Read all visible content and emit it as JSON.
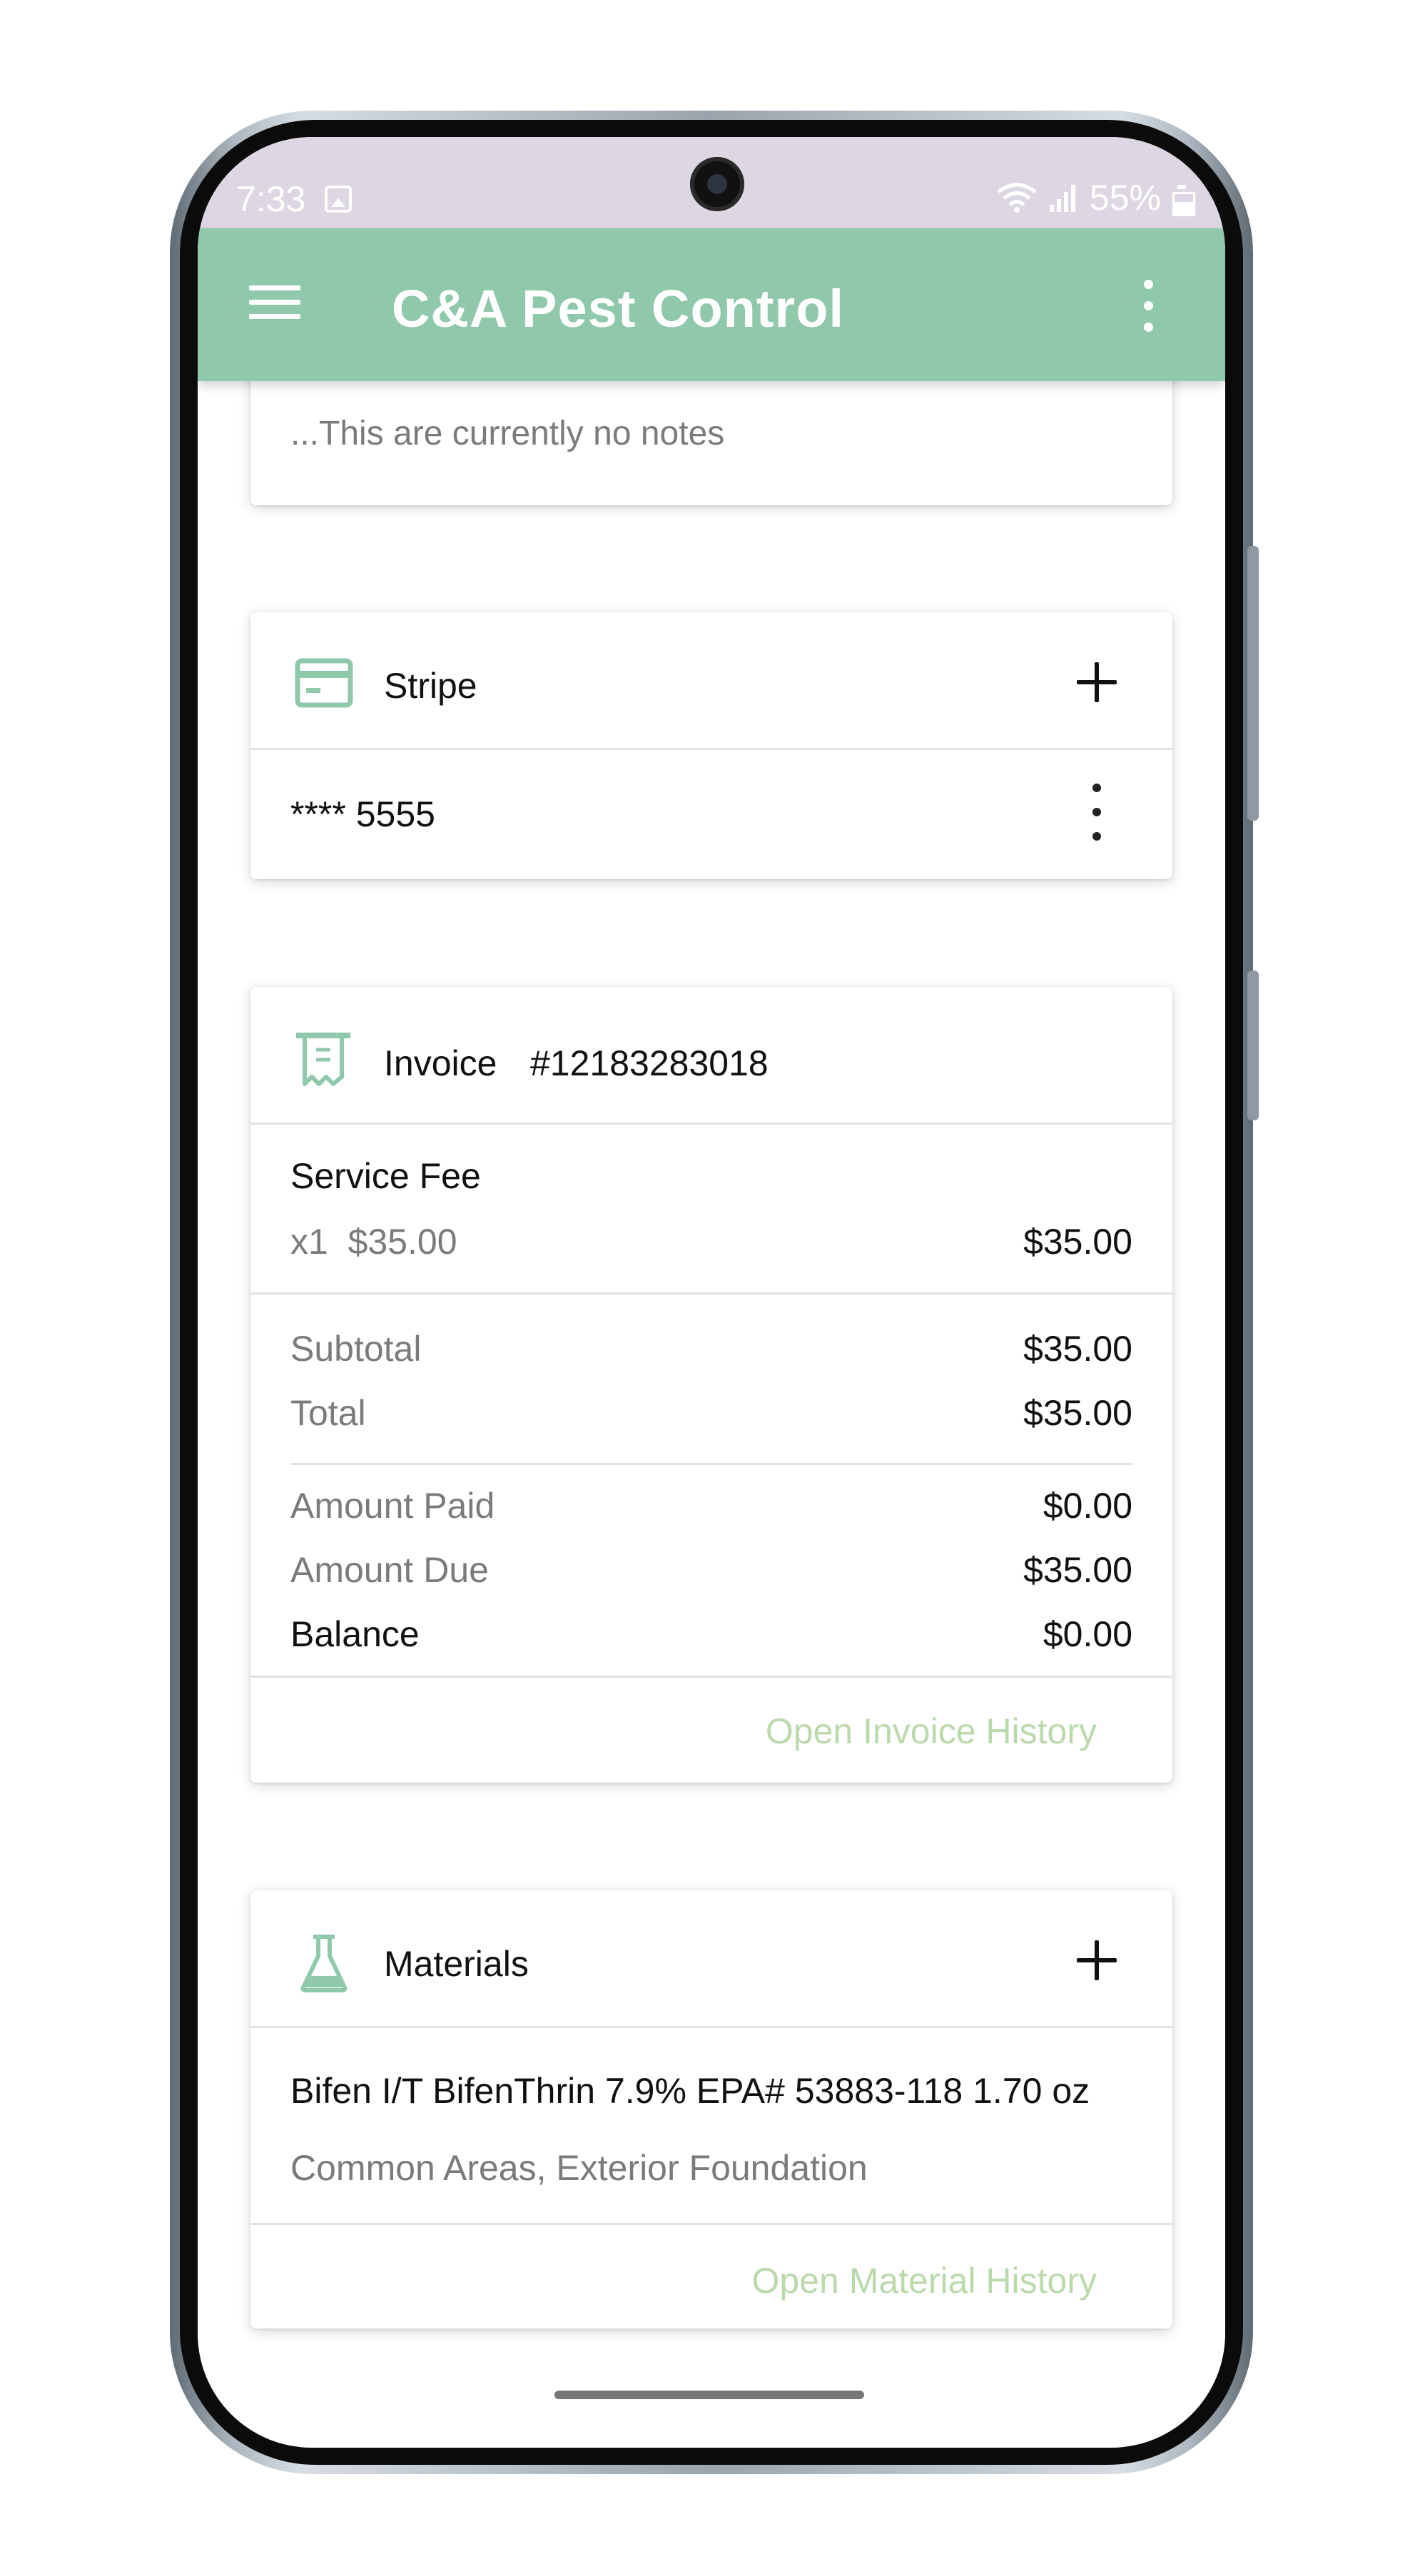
{
  "status_bar": {
    "time": "7:33",
    "battery": "55%"
  },
  "app_bar": {
    "title": "C&A Pest Control"
  },
  "notes": {
    "text": "...This are currently no notes"
  },
  "stripe": {
    "title": "Stripe",
    "card_masked": "**** 5555"
  },
  "invoice": {
    "label": "Invoice",
    "number": "#12183283018",
    "line_item": {
      "name": "Service Fee",
      "qty_price": "x1  $35.00",
      "amount": "$35.00"
    },
    "summary": [
      {
        "label": "Subtotal",
        "value": "$35.00"
      },
      {
        "label": "Total",
        "value": "$35.00"
      }
    ],
    "payments": [
      {
        "label": "Amount Paid",
        "value": "$0.00"
      },
      {
        "label": "Amount Due",
        "value": "$35.00"
      },
      {
        "label": "Balance",
        "value": "$0.00"
      }
    ],
    "history_link": "Open Invoice History"
  },
  "materials": {
    "title": "Materials",
    "item_name": "Bifen I/T BifenThrin 7.9% EPA# 53883-118 1.70 oz",
    "item_areas": "Common Areas, Exterior Foundation",
    "history_link": "Open Material History"
  },
  "colors": {
    "accent": "#90c8ac",
    "status_bar": "#ddd7e4",
    "link": "#bcd9ad"
  }
}
